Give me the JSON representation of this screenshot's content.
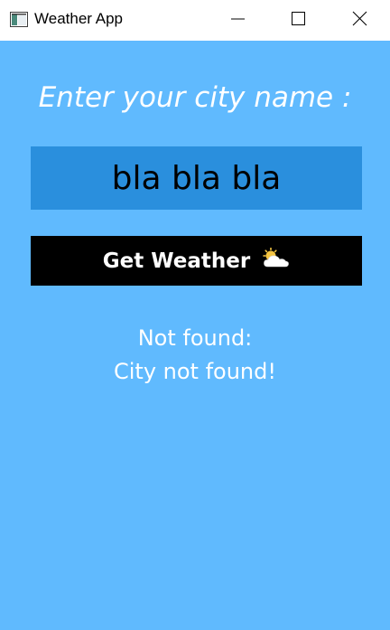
{
  "window": {
    "title": "Weather App",
    "app_icon": "app-window-icon",
    "controls": {
      "minimize_icon": "minimize-icon",
      "maximize_icon": "maximize-icon",
      "close_icon": "close-icon"
    }
  },
  "main": {
    "prompt": "Enter your city name :",
    "city_input_value": "bla bla bla",
    "get_weather_label": "Get Weather",
    "get_weather_icon": "sun-behind-cloud-icon",
    "result_line1": "Not found:",
    "result_line2": "City not found!"
  },
  "colors": {
    "background": "#60bafe",
    "input_background": "#2a8fdd",
    "button_background": "#000000",
    "text_white": "#ffffff"
  }
}
